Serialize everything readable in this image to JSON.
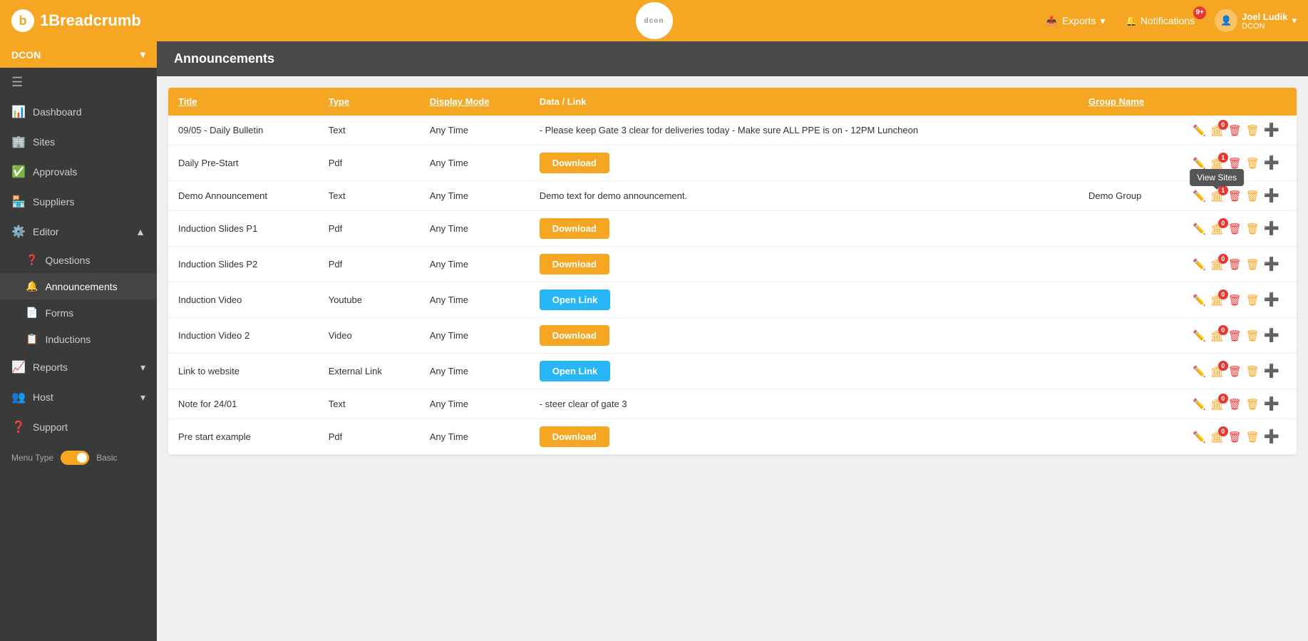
{
  "brand": {
    "logo_letter": "b",
    "name": "1Breadcrumb"
  },
  "center_logo": "dcon",
  "top_nav": {
    "exports_label": "Exports",
    "exports_icon": "📤",
    "notifications_label": "Notifications",
    "notifications_badge": "9+",
    "user_name": "Joel Ludik",
    "user_org": "DCON",
    "user_icon": "👤",
    "dropdown_icon": "▾"
  },
  "sidebar": {
    "org_name": "DCON",
    "menu_toggle": "☰",
    "items": [
      {
        "id": "dashboard",
        "label": "Dashboard",
        "icon": "📊"
      },
      {
        "id": "sites",
        "label": "Sites",
        "icon": "🏢"
      },
      {
        "id": "approvals",
        "label": "Approvals",
        "icon": "✅"
      },
      {
        "id": "suppliers",
        "label": "Suppliers",
        "icon": "🏪"
      },
      {
        "id": "editor",
        "label": "Editor",
        "icon": "⚙️",
        "has_arrow": true
      },
      {
        "id": "questions",
        "label": "Questions",
        "icon": "❓",
        "sub": true
      },
      {
        "id": "announcements",
        "label": "Announcements",
        "icon": "🔔",
        "sub": true,
        "active": true
      },
      {
        "id": "forms",
        "label": "Forms",
        "icon": "📄",
        "sub": true
      },
      {
        "id": "inductions",
        "label": "Inductions",
        "icon": "📋",
        "sub": true
      },
      {
        "id": "reports",
        "label": "Reports",
        "icon": "📈",
        "has_arrow": true
      },
      {
        "id": "host",
        "label": "Host",
        "icon": "👥",
        "has_arrow": true
      },
      {
        "id": "support",
        "label": "Support",
        "icon": "❓"
      }
    ],
    "menu_type_label": "Menu Type",
    "menu_type_value": "Basic"
  },
  "page": {
    "title": "Announcements"
  },
  "table": {
    "headers": [
      {
        "id": "title",
        "label": "Title",
        "sortable": true
      },
      {
        "id": "type",
        "label": "Type",
        "sortable": true
      },
      {
        "id": "display_mode",
        "label": "Display Mode",
        "sortable": true
      },
      {
        "id": "data_link",
        "label": "Data / Link",
        "sortable": false
      },
      {
        "id": "group_name",
        "label": "Group Name",
        "sortable": true
      },
      {
        "id": "actions",
        "label": "",
        "sortable": false
      }
    ],
    "rows": [
      {
        "title": "09/05 - Daily Bulletin",
        "type": "Text",
        "display_mode": "Any Time",
        "data_link": "- Please keep Gate 3 clear for deliveries today - Make sure ALL PPE is on - 12PM Luncheon",
        "group_name": "",
        "action_type": "none",
        "building_badge": "0"
      },
      {
        "title": "Daily Pre-Start",
        "type": "Pdf",
        "display_mode": "Any Time",
        "data_link": "",
        "group_name": "",
        "action_type": "download",
        "btn_label": "Download",
        "building_badge": "1"
      },
      {
        "title": "Demo Announcement",
        "type": "Text",
        "display_mode": "Any Time",
        "data_link": "Demo text for demo announcement.",
        "group_name": "Demo Group",
        "action_type": "none",
        "building_badge": "1",
        "show_tooltip": true
      },
      {
        "title": "Induction Slides P1",
        "type": "Pdf",
        "display_mode": "Any Time",
        "data_link": "",
        "group_name": "",
        "action_type": "download",
        "btn_label": "Download",
        "building_badge": "0"
      },
      {
        "title": "Induction Slides P2",
        "type": "Pdf",
        "display_mode": "Any Time",
        "data_link": "",
        "group_name": "",
        "action_type": "download",
        "btn_label": "Download",
        "building_badge": "0"
      },
      {
        "title": "Induction Video",
        "type": "Youtube",
        "display_mode": "Any Time",
        "data_link": "",
        "group_name": "",
        "action_type": "open_link",
        "btn_label": "Open Link",
        "building_badge": "0"
      },
      {
        "title": "Induction Video 2",
        "type": "Video",
        "display_mode": "Any Time",
        "data_link": "",
        "group_name": "",
        "action_type": "download",
        "btn_label": "Download",
        "building_badge": "0"
      },
      {
        "title": "Link to website",
        "type": "External Link",
        "display_mode": "Any Time",
        "data_link": "",
        "group_name": "",
        "action_type": "open_link",
        "btn_label": "Open Link",
        "building_badge": "0"
      },
      {
        "title": "Note for 24/01",
        "type": "Text",
        "display_mode": "Any Time",
        "data_link": "- steer clear of gate 3",
        "group_name": "",
        "action_type": "none",
        "building_badge": "0"
      },
      {
        "title": "Pre start example",
        "type": "Pdf",
        "display_mode": "Any Time",
        "data_link": "",
        "group_name": "",
        "action_type": "download",
        "btn_label": "Download",
        "building_badge": "0"
      }
    ]
  },
  "tooltip": {
    "view_sites": "View Sites"
  }
}
